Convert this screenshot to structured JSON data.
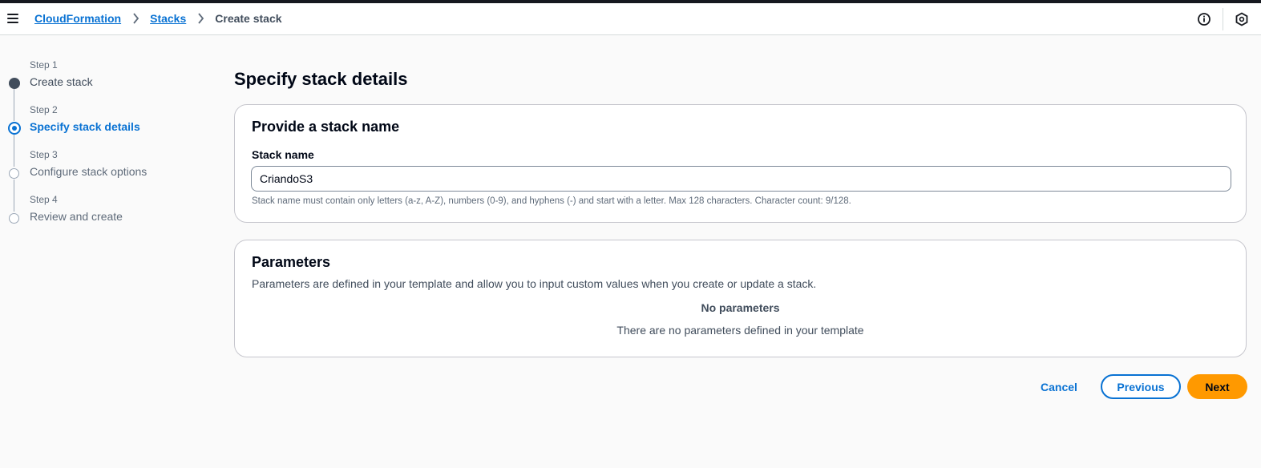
{
  "breadcrumb": {
    "items": [
      "CloudFormation",
      "Stacks"
    ],
    "current": "Create stack"
  },
  "header_icons": [
    "info-icon",
    "hexagon-icon"
  ],
  "steps": [
    {
      "number": "Step 1",
      "title": "Create stack",
      "state": "completed"
    },
    {
      "number": "Step 2",
      "title": "Specify stack details",
      "state": "active"
    },
    {
      "number": "Step 3",
      "title": "Configure stack options",
      "state": "pending"
    },
    {
      "number": "Step 4",
      "title": "Review and create",
      "state": "pending"
    }
  ],
  "page_title": "Specify stack details",
  "stack_name_section": {
    "title": "Provide a stack name",
    "label": "Stack name",
    "value": "CriandoS3",
    "constraint": "Stack name must contain only letters (a-z, A-Z), numbers (0-9), and hyphens (-) and start with a letter. Max 128 characters. Character count: 9/128."
  },
  "parameters_section": {
    "title": "Parameters",
    "description": "Parameters are defined in your template and allow you to input custom values when you create or update a stack.",
    "empty_title": "No parameters",
    "empty_text": "There are no parameters defined in your template"
  },
  "actions": {
    "cancel": "Cancel",
    "previous": "Previous",
    "next": "Next"
  },
  "colors": {
    "link": "#0972d3",
    "primary_button": "#ff9900",
    "text": "#000716"
  }
}
